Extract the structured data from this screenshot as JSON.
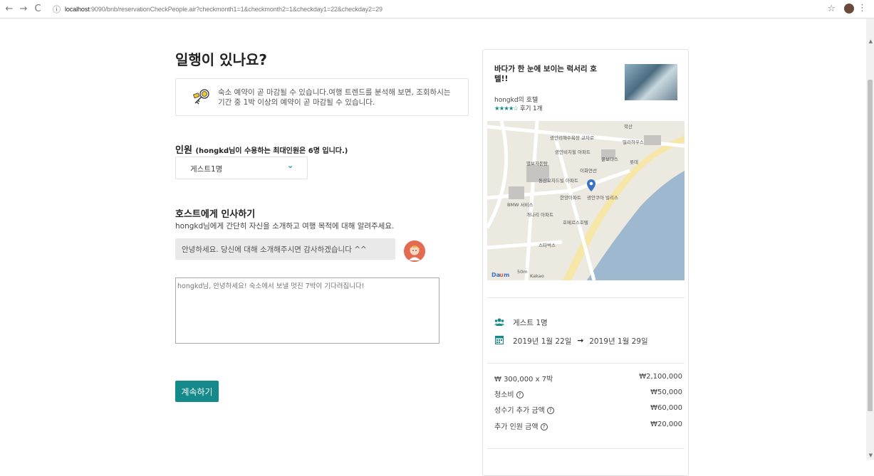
{
  "browser": {
    "url_host": "localhost",
    "url_path": ":9090/bnb/reservationCheckPeople.air?checkmonth1=1&checkmonth2=1&checkday1=22&checkday2=29"
  },
  "page": {
    "title": "일행이 있나요?",
    "notice": "숙소 예약이 곧 마감될 수 있습니다.여행 트렌드를 분석해 보면, 조회하시는 기간 중 1박 이상의 예약이 곧 마감될 수 있습니다."
  },
  "guests": {
    "heading": "인원",
    "note": "(hongkd님이 수용하는 최대인원은 6명 입니다.)",
    "selected": "게스트1명"
  },
  "host": {
    "heading": "호스트에게 인사하기",
    "description": "hongkd님에게 간단히 자신을 소개하고 여행 목적에 대해 알려주세요.",
    "message": "안녕하세요. 당신에 대해 소개해주시면 감사하겠습니다 ^^",
    "textarea_placeholder": "hongkd님, 안녕하세요! 숙소에서 보낼 멋진 7박이 기다려집니다!"
  },
  "continue_label": "계속하기",
  "listing": {
    "title": "바다가 한 눈에 보이는 럭서리 호텔!!",
    "host": "hongkd의 호텔",
    "stars": "★★★★☆",
    "reviews": "후기 1개",
    "map_labels": [
      "광안리해수욕장 교차로",
      "광안비치힐 아파트",
      "별보자돈탐",
      "동산오차드빌 아파트",
      "한양아파트",
      "광안쿠아 빌리스",
      "BMW 서비스",
      "개나리 아파트",
      "호메르스호텔",
      "스타벅스",
      "학산",
      "밀리하우스",
      "꿀보다스",
      "롯데",
      "이화연선",
      "Kakao",
      "50m"
    ],
    "guest_count": "게스트 1명",
    "date_from": "2019년 1월 22일",
    "date_to": "2019년 1월 29일",
    "arrow": "→"
  },
  "prices": [
    {
      "label": "₩ 300,000 x 7박",
      "amount": "₩2,100,000",
      "help": false
    },
    {
      "label": "청소비",
      "amount": "₩50,000",
      "help": true
    },
    {
      "label": "성수기 추가 금액",
      "amount": "₩60,000",
      "help": true
    },
    {
      "label": "추가 인원 금액",
      "amount": "₩20,000",
      "help": true
    }
  ]
}
